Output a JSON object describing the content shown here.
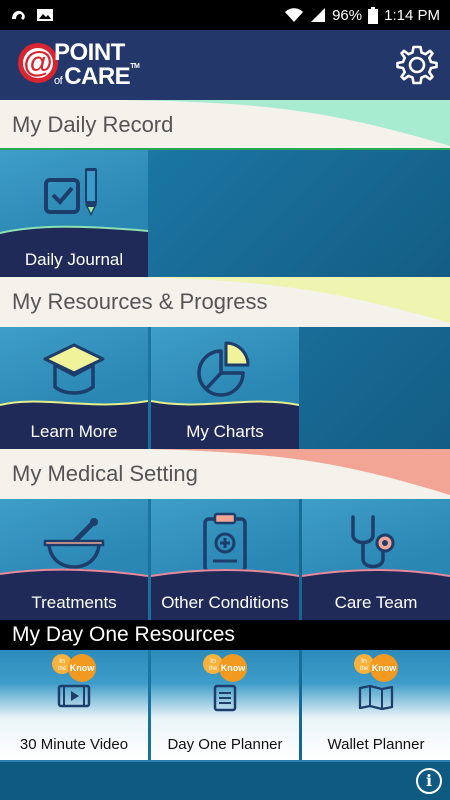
{
  "status_bar": {
    "battery": "96%",
    "time": "1:14 PM"
  },
  "app": {
    "logo": {
      "at": "@",
      "word1": "POINT",
      "of": "of",
      "word2": "CARE",
      "tm": "TM"
    },
    "settings_icon": "gear-icon"
  },
  "sections": {
    "daily_record": "My Daily Record",
    "resources_progress": "My Resources & Progress",
    "medical_setting": "My Medical Setting",
    "day_one": "My Day One Resources"
  },
  "tiles": {
    "daily_journal": {
      "label": "Daily Journal",
      "icon": "journal-checkbox-pencil-icon"
    },
    "learn_more": {
      "label": "Learn More",
      "icon": "graduation-cap-icon"
    },
    "my_charts": {
      "label": "My Charts",
      "icon": "pie-chart-icon"
    },
    "treatments": {
      "label": "Treatments",
      "icon": "mortar-pestle-icon"
    },
    "other_conditions": {
      "label": "Other Conditions",
      "icon": "clipboard-medical-icon"
    },
    "care_team": {
      "label": "Care Team",
      "icon": "stethoscope-icon"
    },
    "thirty_minute_video": {
      "label": "30 Minute Video",
      "icon": "video-icon"
    },
    "day_one_planner": {
      "label": "Day One Planner",
      "icon": "planner-list-icon"
    },
    "wallet_planner": {
      "label": "Wallet Planner",
      "icon": "wallet-map-icon"
    }
  },
  "badge": {
    "in": "In",
    "the": "the",
    "know": "Know"
  },
  "footer": {
    "info_label": "i"
  },
  "colors": {
    "appbar": "#24376a",
    "accent_green": "#9fe6c4",
    "accent_yellow": "#eff2a8",
    "accent_red": "#ef9b8c",
    "tile_dark": "#1f2a58",
    "badge_orange": "#f29a1f"
  }
}
